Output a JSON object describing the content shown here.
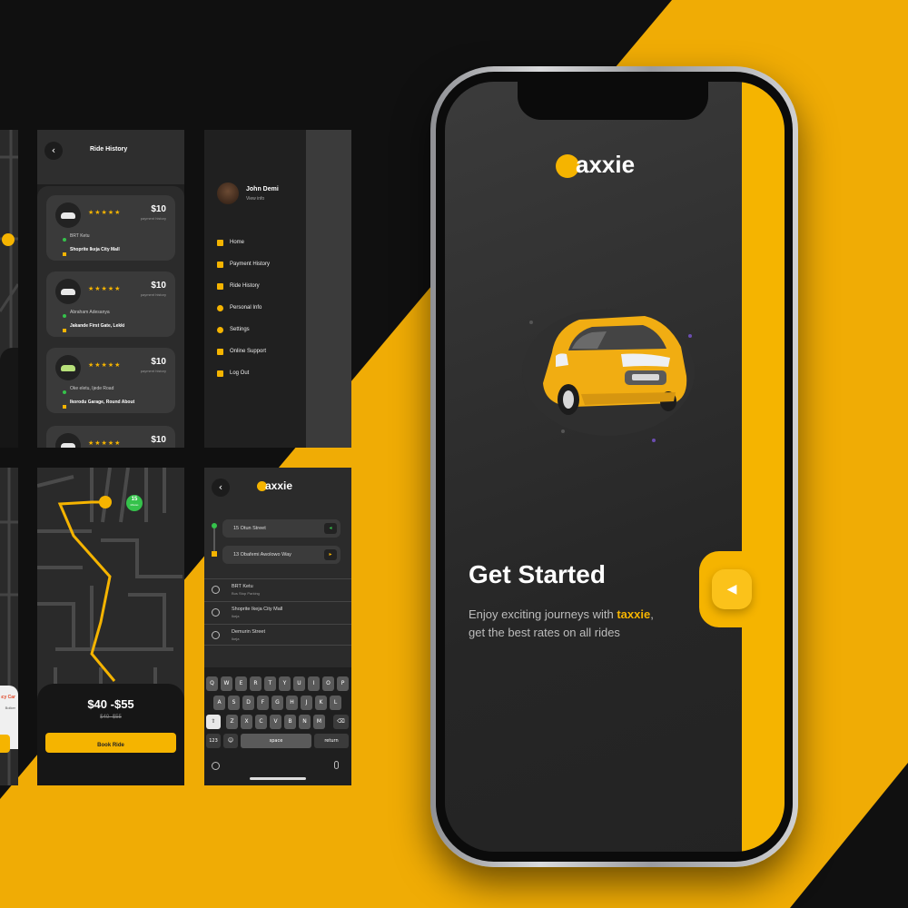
{
  "colors": {
    "accent": "#f5b400",
    "dark": "#2b2b2b",
    "background": "#101010",
    "success": "#35c24b"
  },
  "ride_history": {
    "title": "Ride History",
    "rides": [
      {
        "price": "$10",
        "price_sub": "payment history",
        "rating": "★★★★★",
        "from": "BRT Ketu",
        "to": "Shoprite Ikeja City Mall"
      },
      {
        "price": "$10",
        "price_sub": "payment history",
        "rating": "★★★★★",
        "from": "Abraham Adesanya",
        "to": "Jakande First Gate, Lekki"
      },
      {
        "price": "$10",
        "price_sub": "payment history",
        "rating": "★★★★★",
        "from": "Oke eletu, Ijede Road",
        "to": "Ikorodu Garage, Round About"
      },
      {
        "price": "$10",
        "price_sub": "payment history",
        "rating": "★★★★★",
        "from": "",
        "to": ""
      }
    ]
  },
  "menu": {
    "user_name": "John Demi",
    "user_sub": "View info",
    "items": [
      "Home",
      "Payment History",
      "Ride History",
      "Personal Info",
      "Settings",
      "Online Support",
      "Log Out"
    ]
  },
  "booking": {
    "eta": "15",
    "eta_unit": "Minutes",
    "price_range": "$40 -$55",
    "old_price": "$40 -$55",
    "book_button": "Book Ride",
    "left_label": "Emergency Car",
    "left_sub": "Bolker"
  },
  "search": {
    "logo_rest": "axxie",
    "from": "15 Otun Street",
    "to": "13 Obafemi Awolowo Way",
    "recents": [
      {
        "title": "BRT Ketu",
        "sub": "Bus Stop Parking"
      },
      {
        "title": "Shoprite Ikeja City Mall",
        "sub": "Ikeja"
      },
      {
        "title": "Demurin Street",
        "sub": "Ikeja"
      }
    ],
    "keyboard": {
      "row1": [
        "Q",
        "W",
        "E",
        "R",
        "T",
        "Y",
        "U",
        "I",
        "O",
        "P"
      ],
      "row2": [
        "A",
        "S",
        "D",
        "F",
        "G",
        "H",
        "J",
        "K",
        "L"
      ],
      "row3": [
        "Z",
        "X",
        "C",
        "V",
        "B",
        "N",
        "M"
      ],
      "num": "123",
      "space": "space",
      "return": "return"
    }
  },
  "main": {
    "logo_rest": "axxie",
    "heading": "Get Started",
    "desc_prefix": "Enjoy exciting journeys with ",
    "desc_brand": "taxxie",
    "desc_suffix": ",",
    "desc_line2": "get the best rates on all rides"
  }
}
